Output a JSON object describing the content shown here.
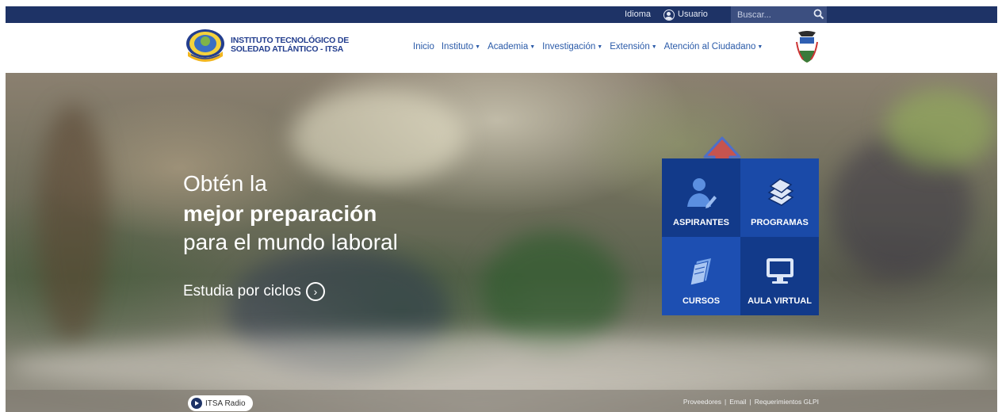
{
  "topbar": {
    "language_label": "Idioma",
    "user_label": "Usuario",
    "search_placeholder": "Buscar..."
  },
  "header": {
    "logo_line1": "INSTITUTO TECNOLÓGICO DE",
    "logo_line2": "SOLEDAD ATLÁNTICO - ITSA",
    "nav": [
      {
        "label": "Inicio",
        "dropdown": false
      },
      {
        "label": "Instituto",
        "dropdown": true
      },
      {
        "label": "Academia",
        "dropdown": true
      },
      {
        "label": "Investigación",
        "dropdown": true
      },
      {
        "label": "Extensión",
        "dropdown": true
      },
      {
        "label": "Atención al Ciudadano",
        "dropdown": true
      }
    ]
  },
  "hero": {
    "line1": "Obtén la",
    "line2": "mejor preparación",
    "line3": "para el mundo laboral",
    "cta_label": "Estudia por ciclos"
  },
  "tiles": [
    {
      "label": "ASPIRANTES",
      "icon": "user-pen-icon"
    },
    {
      "label": "PROGRAMAS",
      "icon": "books-icon"
    },
    {
      "label": "CURSOS",
      "icon": "pages-icon"
    },
    {
      "label": "AULA VIRTUAL",
      "icon": "monitor-icon"
    }
  ],
  "bottombar": {
    "radio_label": "ITSA Radio",
    "links": [
      "Proveedores",
      "Email",
      "Requerimientos GLPI"
    ]
  },
  "colors": {
    "topbar_bg": "#1e3366",
    "nav_link": "#2a5aa8",
    "tile_dark": "#123a8a",
    "tile_mid": "#1d4fb2",
    "arrow_fill": "#c6544f",
    "arrow_outline": "#4f6fc7"
  }
}
